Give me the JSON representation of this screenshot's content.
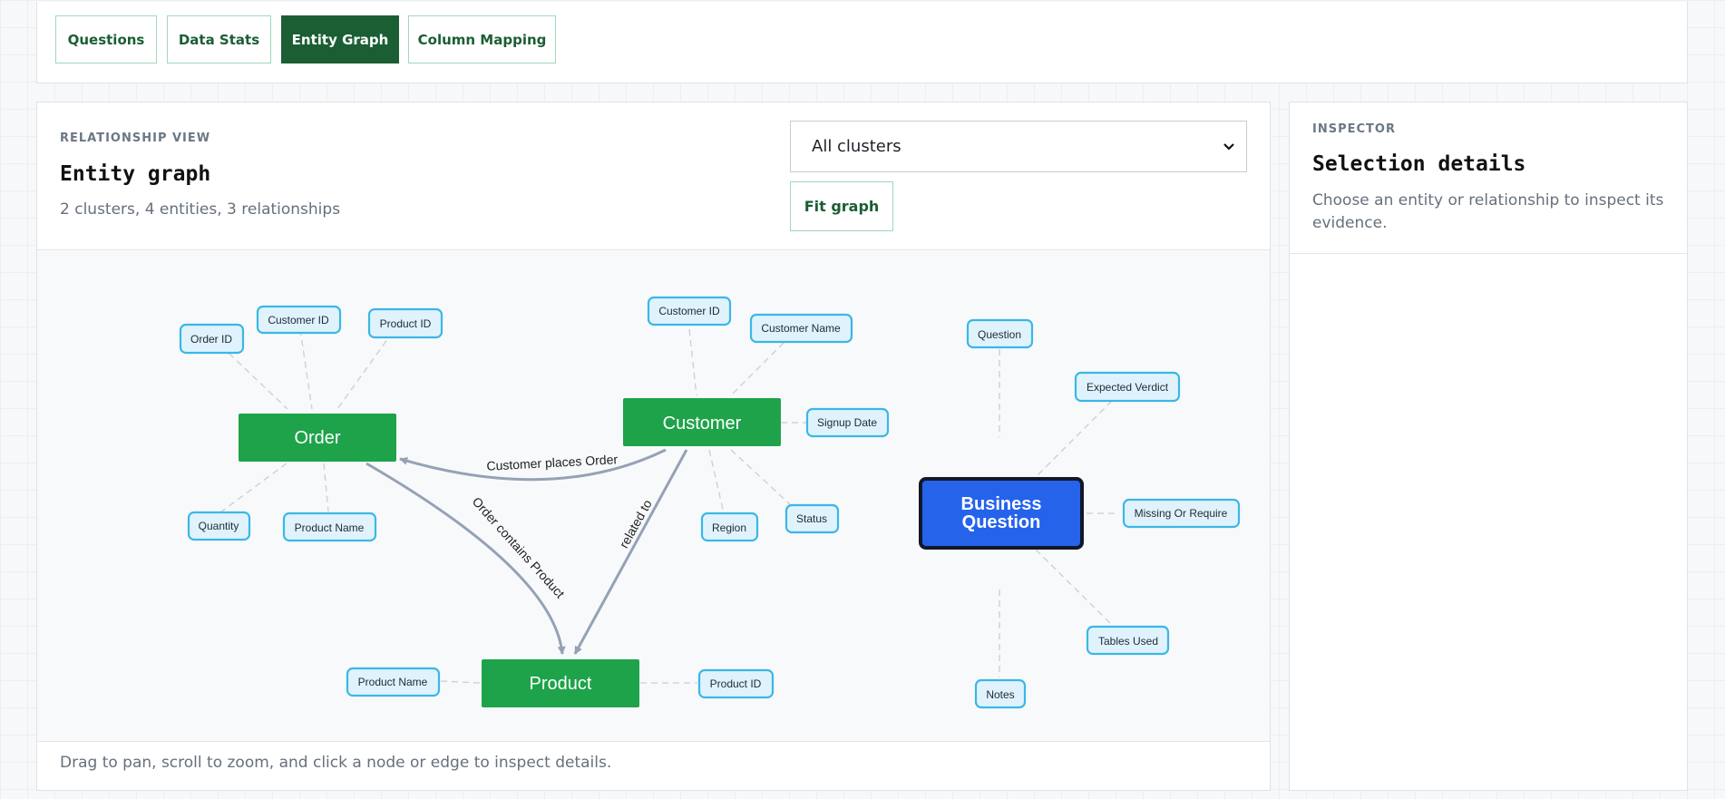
{
  "tabs": [
    {
      "label": "Questions",
      "active": false
    },
    {
      "label": "Data Stats",
      "active": false
    },
    {
      "label": "Entity Graph",
      "active": true
    },
    {
      "label": "Column Mapping",
      "active": false
    }
  ],
  "graph_panel": {
    "eyebrow": "RELATIONSHIP VIEW",
    "title": "Entity graph",
    "summary": "2 clusters, 4 entities, 3 relationships",
    "cluster_select": {
      "selected": "All clusters"
    },
    "fit_button": "Fit graph",
    "hint": "Drag to pan, scroll to zoom, and click a node or edge to inspect details."
  },
  "inspector": {
    "eyebrow": "INSPECTOR",
    "title": "Selection details",
    "description": "Choose an entity or relationship to inspect its evidence."
  },
  "graph": {
    "entities": [
      {
        "id": "order",
        "label": "Order"
      },
      {
        "id": "customer",
        "label": "Customer"
      },
      {
        "id": "product",
        "label": "Product"
      },
      {
        "id": "bq",
        "label_lines": [
          "Business",
          "Question"
        ],
        "selected": true
      }
    ],
    "attributes": {
      "order": [
        "Order ID",
        "Customer ID",
        "Product ID",
        "Quantity",
        "Product Name"
      ],
      "customer": [
        "Customer ID",
        "Customer Name",
        "Signup Date",
        "Status",
        "Region"
      ],
      "product": [
        "Product Name",
        "Product ID"
      ],
      "bq": [
        "Question",
        "Expected Verdict",
        "Missing Or Require",
        "Tables Used",
        "Notes"
      ]
    },
    "relationships": [
      {
        "id": "places",
        "label": "Customer places Order"
      },
      {
        "id": "contains",
        "label": "Order contains Product"
      },
      {
        "id": "related",
        "label": "related to"
      }
    ],
    "colors": {
      "entity_fill": "#1ea34a",
      "selected_fill": "#2563eb",
      "selected_stroke": "#111827",
      "attr_fill": "#e0f3fc",
      "attr_stroke": "#3bb7e6",
      "edge": "#95a1b5",
      "tab_accent": "#1b5e34"
    }
  }
}
